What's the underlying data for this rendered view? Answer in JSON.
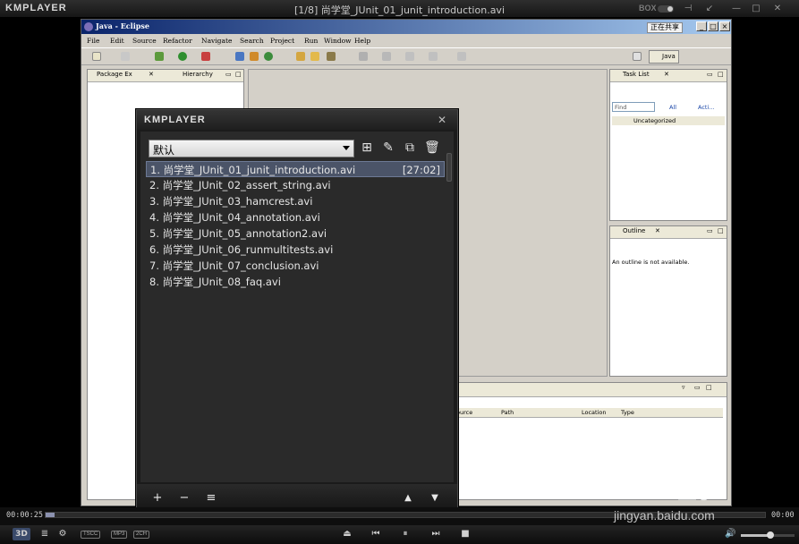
{
  "player": {
    "logo": "KMPLAYER",
    "title": "[1/8] 尚学堂_JUnit_01_junit_introduction.avi",
    "box_label": "BOX"
  },
  "eclipse": {
    "title": "Java - Eclipse",
    "ime": "正在共享",
    "menus": [
      "File",
      "Edit",
      "Source",
      "Refactor",
      "Navigate",
      "Search",
      "Project",
      "Run",
      "Window",
      "Help"
    ],
    "perspective": "Java",
    "left_tabs": [
      "Package Ex",
      "Hierarchy"
    ],
    "task_list": {
      "tab": "Task List",
      "find_placeholder": "Find",
      "filter_all": "All",
      "filter_acti": "Acti...",
      "category": "Uncategorized"
    },
    "outline": {
      "tab": "Outline",
      "message": "An outline is not available."
    },
    "problems_columns": [
      "ource",
      "Path",
      "Location",
      "Type"
    ]
  },
  "playlist": {
    "logo": "KMPLAYER",
    "selected_list": "默认",
    "items": [
      {
        "label": "1. 尚学堂_JUnit_01_junit_introduction.avi",
        "duration": "[27:02]"
      },
      {
        "label": "2. 尚学堂_JUnit_02_assert_string.avi",
        "duration": ""
      },
      {
        "label": "3. 尚学堂_JUnit_03_hamcrest.avi",
        "duration": ""
      },
      {
        "label": "4. 尚学堂_JUnit_04_annotation.avi",
        "duration": ""
      },
      {
        "label": "5. 尚学堂_JUnit_05_annotation2.avi",
        "duration": ""
      },
      {
        "label": "6. 尚学堂_JUnit_06_runmultitests.avi",
        "duration": ""
      },
      {
        "label": "7. 尚学堂_JUnit_07_conclusion.avi",
        "duration": ""
      },
      {
        "label": "8. 尚学堂_JUnit_08_faq.avi",
        "duration": ""
      }
    ]
  },
  "controls": {
    "current_time": "00:00:25",
    "total_time": "00:00",
    "progress": 0.013,
    "badge_3d": "3D",
    "badges": [
      "TSCC",
      "MP3",
      "2CH"
    ],
    "volume": 0.55
  },
  "watermark": {
    "main": "Bai 经验",
    "sub": "jingyan.baidu.com"
  }
}
